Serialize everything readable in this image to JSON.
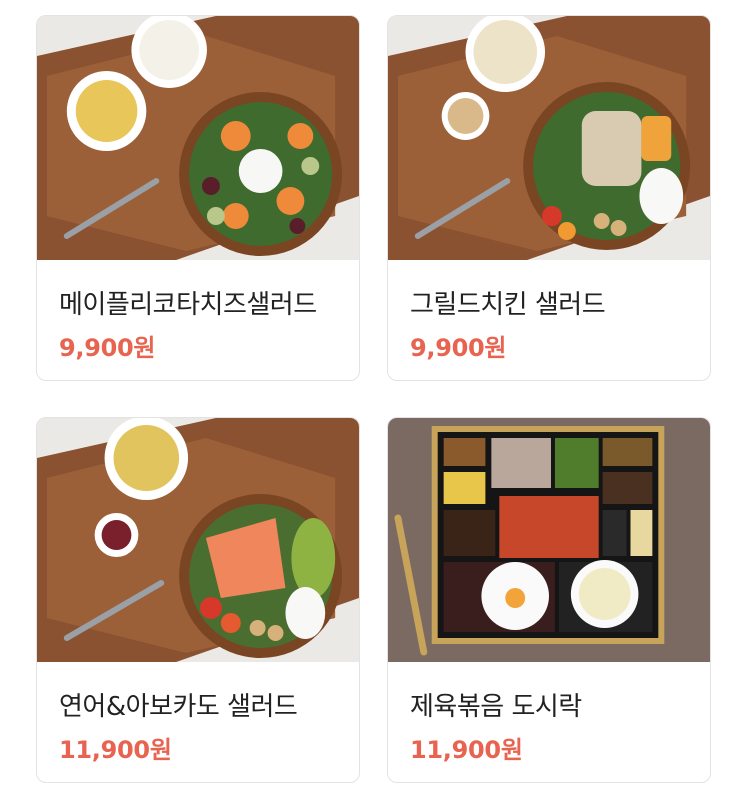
{
  "products": [
    {
      "name": "메이플리코타치즈샐러드",
      "price": "9,900원",
      "image": "maple-ricotta-salad-photo"
    },
    {
      "name": "그릴드치킨 샐러드",
      "price": "9,900원",
      "image": "grilled-chicken-salad-photo"
    },
    {
      "name": "연어&아보카도 샐러드",
      "price": "11,900원",
      "image": "salmon-avocado-salad-photo"
    },
    {
      "name": "제육볶음 도시락",
      "price": "11,900원",
      "image": "spicy-pork-lunchbox-photo"
    }
  ],
  "colors": {
    "price": "#e86450",
    "border": "#e3e3e3",
    "title": "#222222"
  }
}
